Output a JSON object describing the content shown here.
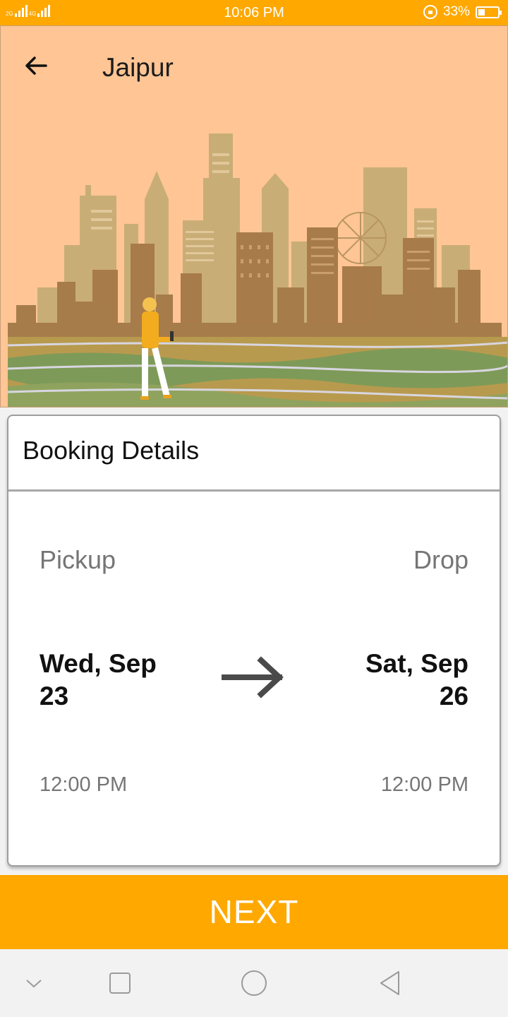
{
  "status_bar": {
    "network_left": "2G",
    "network_right": "4G",
    "time": "10:06 PM",
    "battery_percent": "33%",
    "battery_level": 0.33
  },
  "header": {
    "title": "Jaipur",
    "back_icon": "arrow-left-icon"
  },
  "booking": {
    "title": "Booking Details",
    "pickup": {
      "label": "Pickup",
      "date_line1": "Wed, Sep",
      "date_line2": "23",
      "time": "12:00 PM"
    },
    "drop": {
      "label": "Drop",
      "date_line1": "Sat, Sep",
      "date_line2": "26",
      "time": "12:00 PM"
    },
    "arrow_icon": "arrow-right-icon"
  },
  "next_button": {
    "label": "NEXT"
  },
  "nav_bar": {
    "icons": [
      "chevron-down-icon",
      "square-icon",
      "home-circle-icon",
      "back-triangle-icon"
    ]
  },
  "colors": {
    "accent": "#FFA800",
    "hero_background": "#FFC594",
    "text_primary": "#111111",
    "text_secondary": "#757575"
  }
}
